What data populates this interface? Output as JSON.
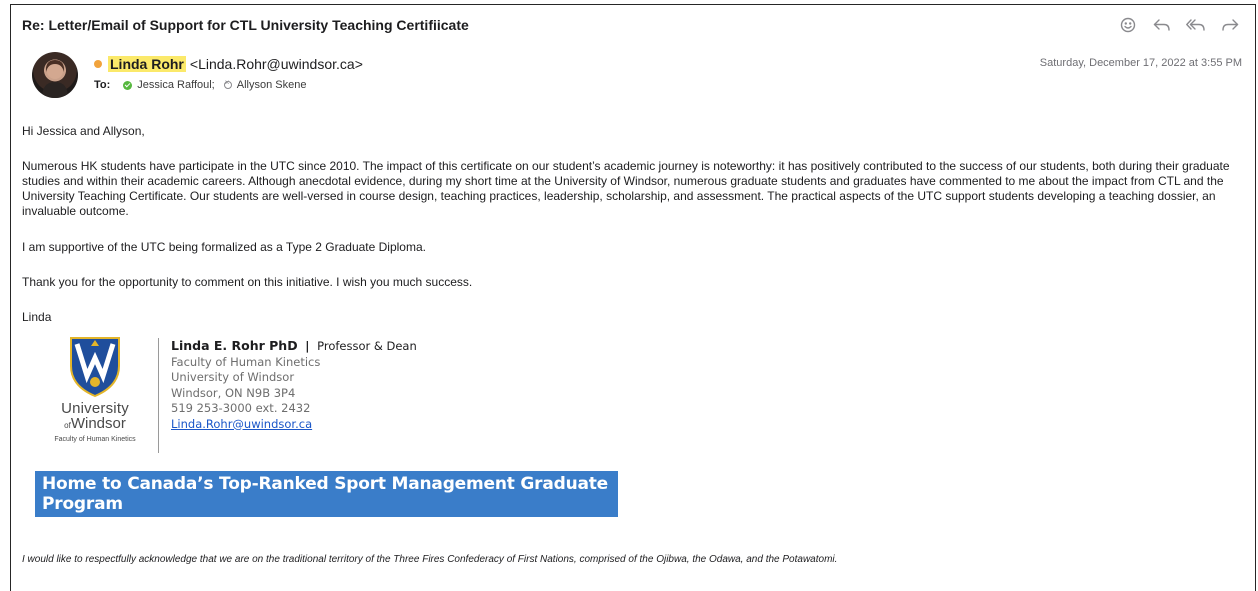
{
  "subject": "Re: Letter/Email of Support for CTL University Teaching Certifiicate",
  "toolbar": {
    "icons": [
      "smiley-icon",
      "reply-icon",
      "reply-all-icon",
      "forward-icon"
    ]
  },
  "sender": {
    "name": "Linda Rohr",
    "email": "<Linda.Rohr@uwindsor.ca>"
  },
  "recipients": {
    "label": "To:",
    "list": [
      "Jessica Raffoul;",
      "Allyson Skene"
    ]
  },
  "date": "Saturday, December 17, 2022 at 3:55 PM",
  "body": {
    "greeting": "Hi Jessica and Allyson,",
    "paragraph1": "Numerous HK students have participate in the UTC since 2010. The impact of this certificate on our student’s academic journey is noteworthy: it has positively contributed to the success of our students, both during their graduate studies and within their academic careers. Although anecdotal evidence, during my short time at the University of Windsor, numerous graduate students and graduates have commented to me about the impact from CTL and the University Teaching Certificate. Our students are well-versed in course design, teaching practices, leadership, scholarship, and assessment. The practical aspects of the UTC support students developing a teaching dossier, an invaluable outcome.",
    "paragraph2": "I am supportive of the UTC being formalized as a Type 2 Graduate Diploma.",
    "paragraph3": "Thank you for the opportunity to comment on this initiative. I wish you much success.",
    "closing": "Linda"
  },
  "signature": {
    "logo_university": "University",
    "logo_of": "of",
    "logo_windsor": "Windsor",
    "logo_faculty": "Faculty of Human Kinetics",
    "name": "Linda E. Rohr PhD",
    "separator": "|",
    "role": "Professor & Dean",
    "faculty": "Faculty of Human Kinetics",
    "university": "University of Windsor",
    "address": "Windsor, ON N9B 3P4",
    "phone": "519 253-3000 ext. 2432",
    "email": "Linda.Rohr@uwindsor.ca"
  },
  "banner": "Home to Canada’s Top-Ranked Sport Management Graduate Program",
  "acknowledgement": "I would like to respectfully acknowledge that we are on the traditional territory of the Three Fires Confederacy of First Nations, comprised of the Ojibwa, the Odawa, and the Potawatomi.",
  "colors": {
    "sender_highlight": "#fbe96a",
    "banner_bg": "#3a7dc9",
    "link": "#1a56c8",
    "status_green": "#57b83f",
    "status_orange": "#f1a33c"
  }
}
